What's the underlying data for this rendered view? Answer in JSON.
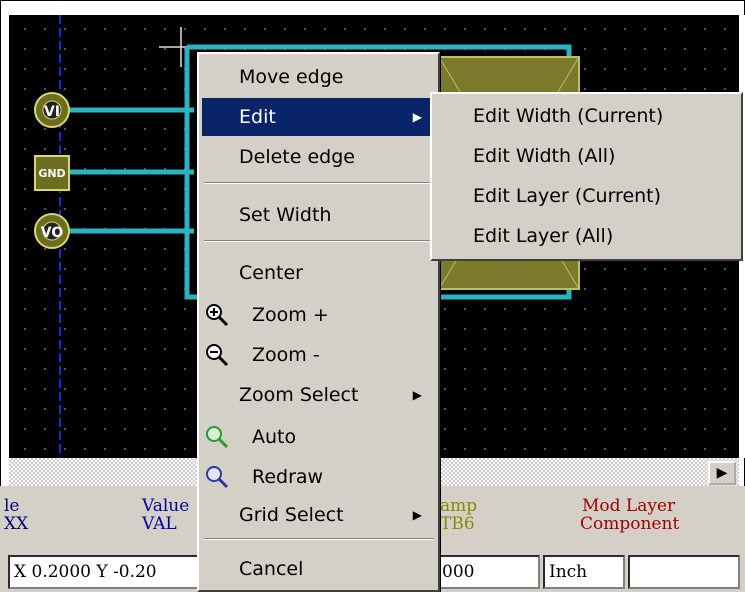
{
  "context_menu": {
    "items": [
      {
        "label": "Move edge"
      },
      {
        "label": "Edit",
        "submenu": true,
        "selected": true
      },
      {
        "label": "Delete edge"
      },
      {
        "label": "Set Width"
      },
      {
        "label": "Center"
      },
      {
        "label": "Zoom +",
        "icon": "zoom-in-icon"
      },
      {
        "label": "Zoom -",
        "icon": "zoom-out-icon"
      },
      {
        "label": "Zoom Select",
        "submenu": true
      },
      {
        "label": "Auto",
        "icon": "zoom-auto-icon"
      },
      {
        "label": "Redraw",
        "icon": "redraw-icon"
      },
      {
        "label": "Grid Select",
        "submenu": true
      },
      {
        "label": "Cancel"
      }
    ]
  },
  "edit_submenu": {
    "items": [
      {
        "label": "Edit Width (Current)"
      },
      {
        "label": "Edit Width (All)"
      },
      {
        "label": "Edit Layer (Current)"
      },
      {
        "label": "Edit Layer (All)"
      }
    ]
  },
  "pads": [
    {
      "label": "VI"
    },
    {
      "label": "GND"
    },
    {
      "label": "VO"
    }
  ],
  "status_panel": {
    "col1_top": "le",
    "col1_bottom": "XX",
    "value_label": "Value",
    "value_text": "VAL",
    "col3_top": "amp",
    "col3_bottom": "TB6",
    "mod_layer_label": "Mod Layer",
    "mod_layer_value": "Component"
  },
  "coords": {
    "position": "X 0.2000  Y -0.20",
    "delta": "000",
    "units": "Inch"
  },
  "colors": {
    "track": "#2ab3c0",
    "pad": "#8a8a3a",
    "menu_bg": "#d4d0c8",
    "menu_highlight": "#0a246a",
    "value_text": "#0000a0",
    "mod_layer_text": "#a00000",
    "col3_text": "#8a8a00"
  }
}
